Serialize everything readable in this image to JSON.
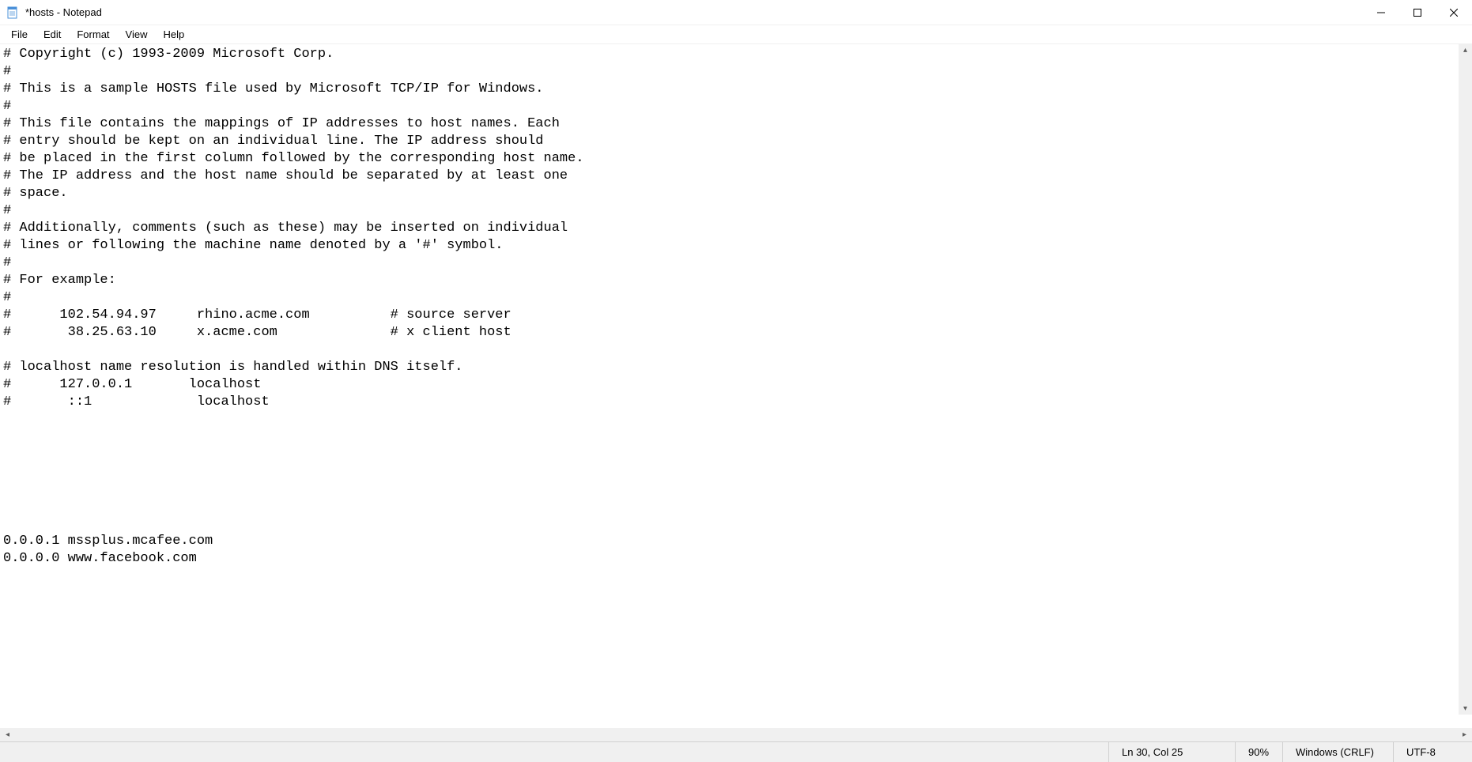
{
  "window": {
    "title": "*hosts - Notepad"
  },
  "menu": {
    "items": [
      "File",
      "Edit",
      "Format",
      "View",
      "Help"
    ]
  },
  "editor": {
    "content": "# Copyright (c) 1993-2009 Microsoft Corp.\n#\n# This is a sample HOSTS file used by Microsoft TCP/IP for Windows.\n#\n# This file contains the mappings of IP addresses to host names. Each\n# entry should be kept on an individual line. The IP address should\n# be placed in the first column followed by the corresponding host name.\n# The IP address and the host name should be separated by at least one\n# space.\n#\n# Additionally, comments (such as these) may be inserted on individual\n# lines or following the machine name denoted by a '#' symbol.\n#\n# For example:\n#\n#      102.54.94.97     rhino.acme.com          # source server\n#       38.25.63.10     x.acme.com              # x client host\n\n# localhost name resolution is handled within DNS itself.\n#      127.0.0.1       localhost\n#       ::1             localhost\n\n\n\n\n\n\n\n0.0.0.1 mssplus.mcafee.com\n0.0.0.0 www.facebook.com"
  },
  "status": {
    "position": "Ln 30, Col 25",
    "zoom": "90%",
    "line_ending": "Windows (CRLF)",
    "encoding": "UTF-8"
  }
}
